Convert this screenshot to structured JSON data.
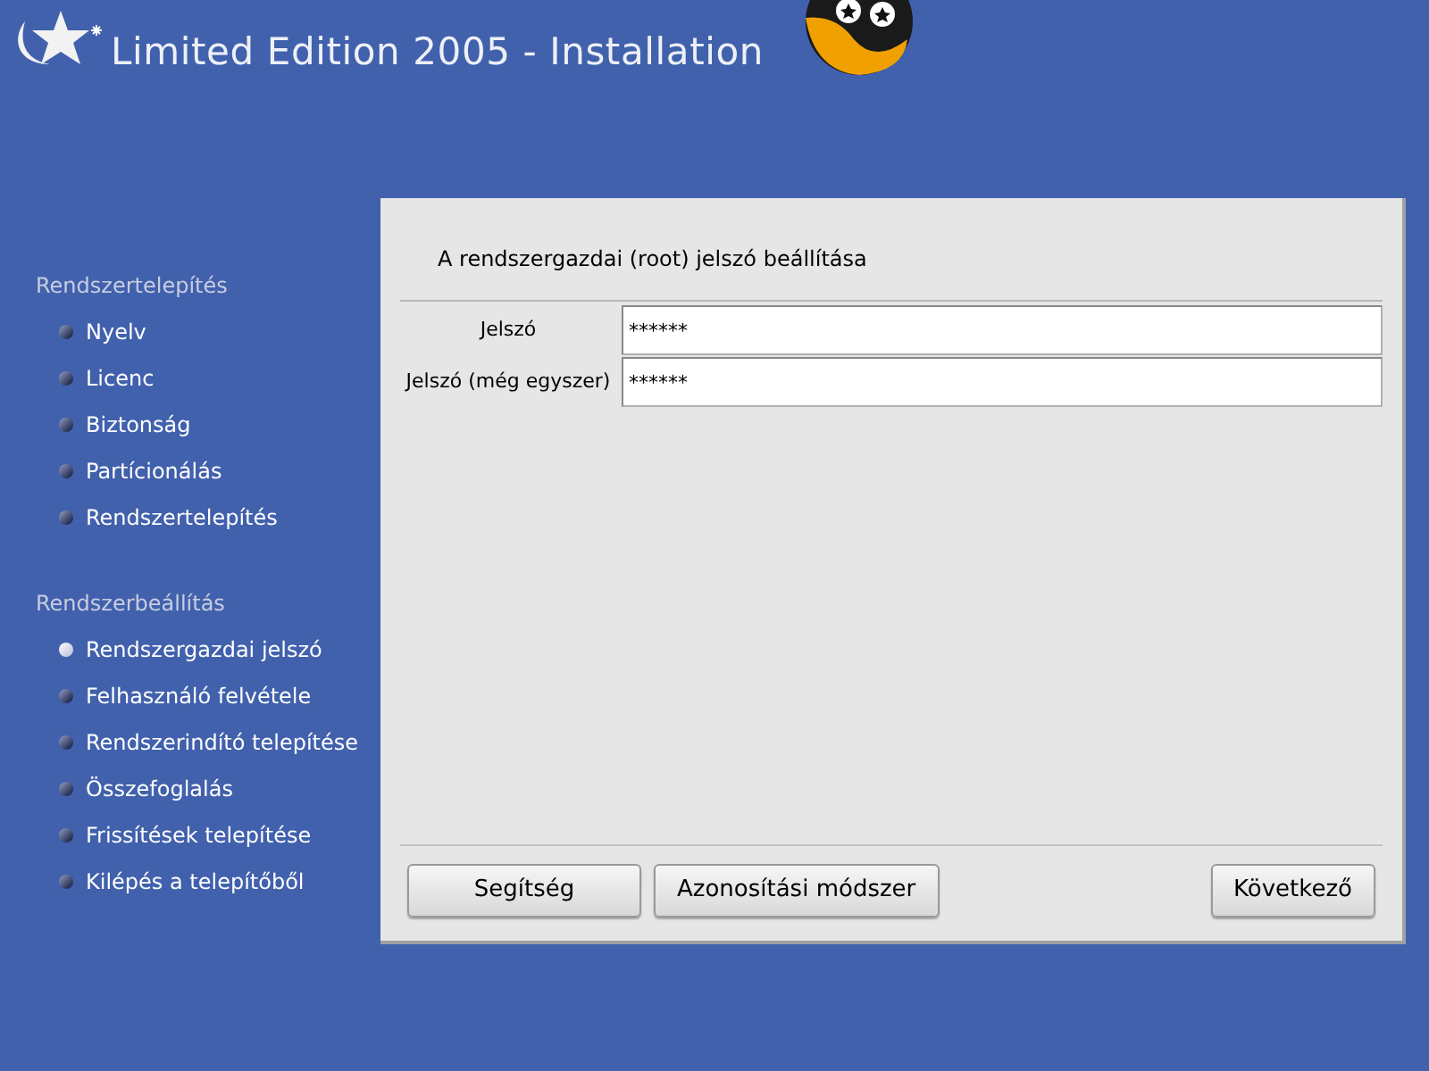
{
  "header": {
    "title": "Limited Edition 2005 - Installation"
  },
  "sidebar": {
    "sections": [
      {
        "title": "Rendszertelepítés",
        "items": [
          {
            "label": "Nyelv",
            "selected": false
          },
          {
            "label": "Licenc",
            "selected": false
          },
          {
            "label": "Biztonság",
            "selected": false
          },
          {
            "label": "Partícionálás",
            "selected": false
          },
          {
            "label": "Rendszertelepítés",
            "selected": false
          }
        ]
      },
      {
        "title": "Rendszerbeállítás",
        "items": [
          {
            "label": "Rendszergazdai jelszó",
            "selected": true
          },
          {
            "label": "Felhasználó felvétele",
            "selected": false
          },
          {
            "label": "Rendszerindító telepítése",
            "selected": false
          },
          {
            "label": "Összefoglalás",
            "selected": false
          },
          {
            "label": "Frissítések telepítése",
            "selected": false
          },
          {
            "label": "Kilépés a telepítőből",
            "selected": false
          }
        ]
      }
    ]
  },
  "panel": {
    "heading": "A rendszergazdai (root) jelszó beállítása",
    "fields": [
      {
        "label": "Jelszó",
        "value": "******"
      },
      {
        "label": "Jelszó (még egyszer)",
        "value": "******"
      }
    ],
    "left_buttons": [
      {
        "label": "Segítség"
      },
      {
        "label": "Azonosítási módszer"
      }
    ],
    "right_buttons": [
      {
        "label": "Következő"
      }
    ]
  }
}
